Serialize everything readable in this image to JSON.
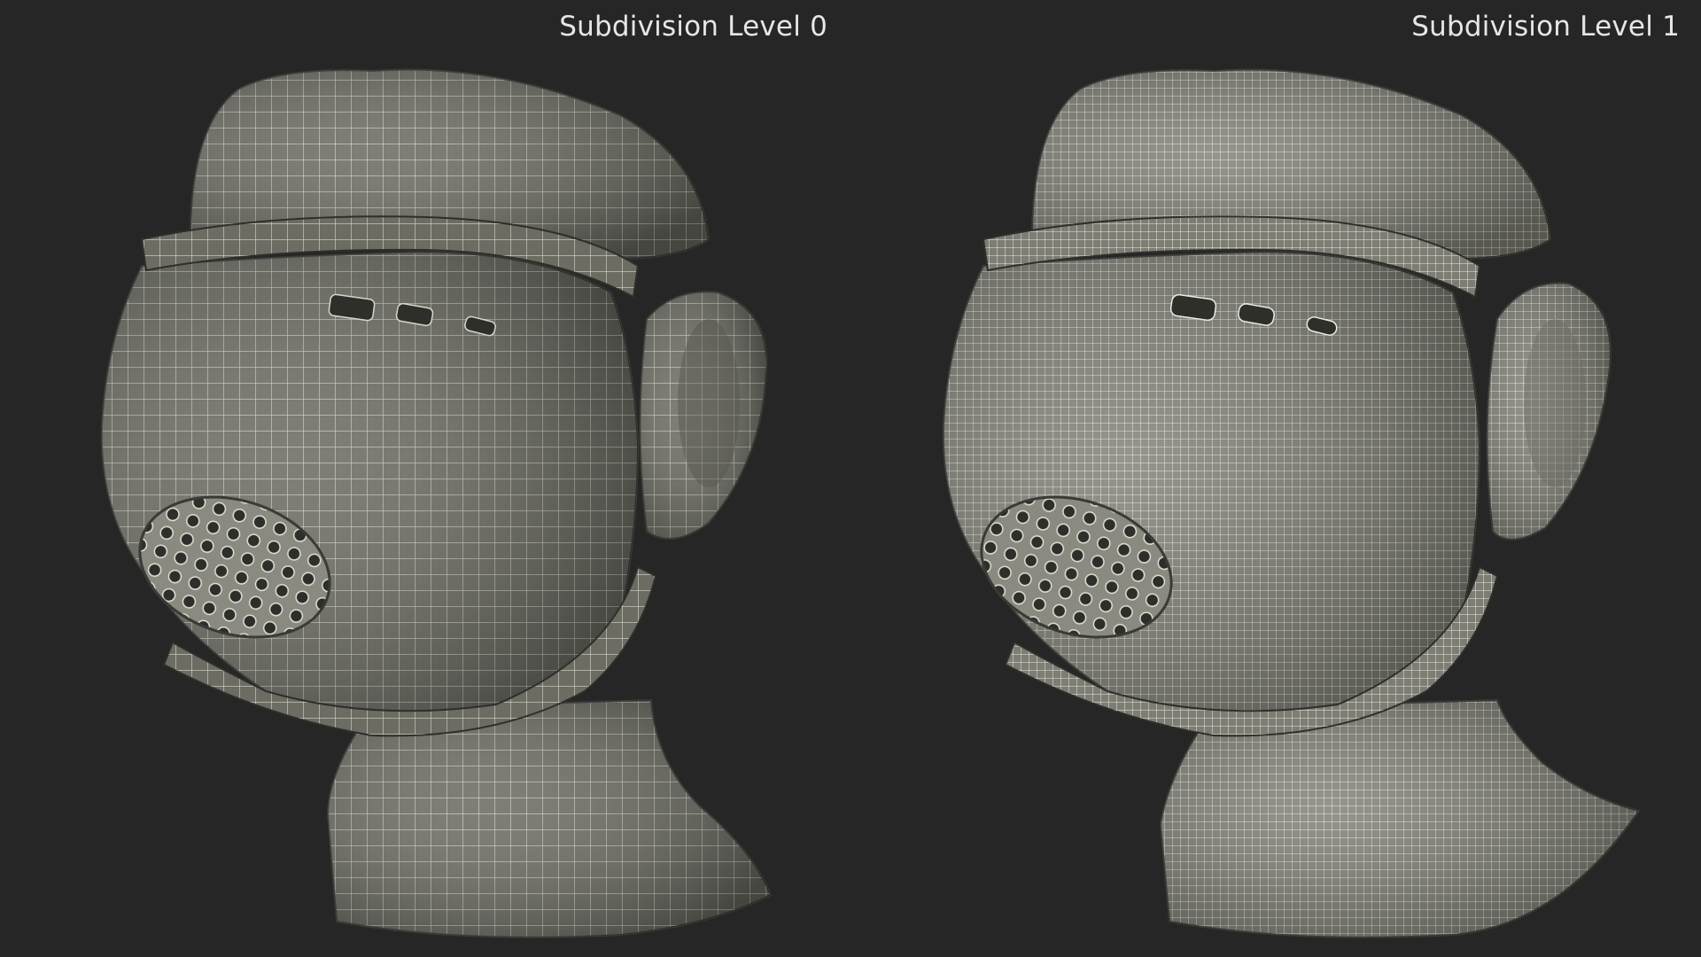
{
  "labels": {
    "left": "Subdivision Level 0",
    "right": "Subdivision Level 1"
  },
  "colors": {
    "background": "#262626",
    "mesh_fill_level0": "#6f6f66",
    "mesh_fill_level1": "#8a8a80",
    "wire_level0": "#d9d9cc",
    "wire_level1": "#efefe2",
    "label_text": "#e6e6e6"
  }
}
